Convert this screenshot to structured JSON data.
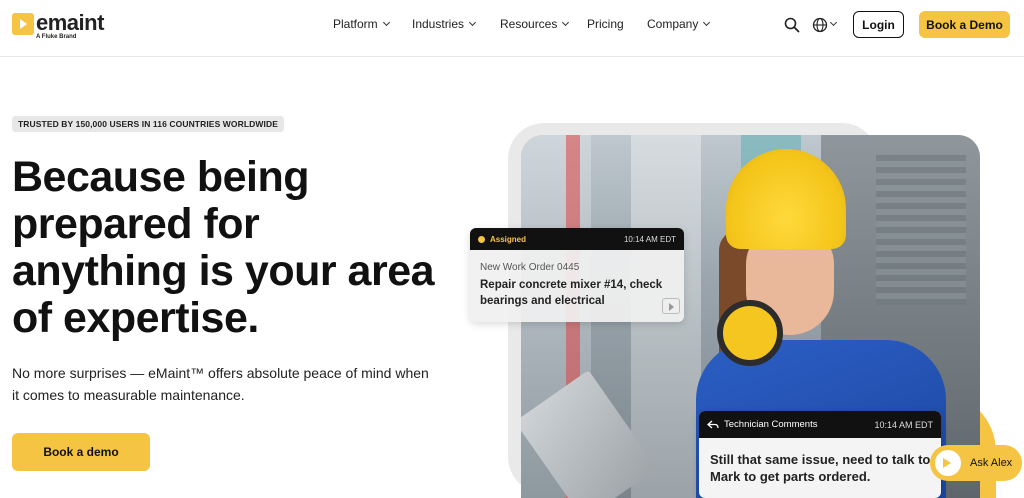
{
  "brand": {
    "name": "emaint",
    "subtitle": "A Fluke Brand",
    "accent": "#f6c443"
  },
  "nav": {
    "items": [
      {
        "label": "Platform",
        "has_dropdown": true
      },
      {
        "label": "Industries",
        "has_dropdown": true
      },
      {
        "label": "Resources",
        "has_dropdown": true
      },
      {
        "label": "Pricing",
        "has_dropdown": false
      },
      {
        "label": "Company",
        "has_dropdown": true
      }
    ],
    "icons": [
      "search-icon",
      "globe-icon"
    ],
    "login_label": "Login",
    "demo_label": "Book a Demo"
  },
  "hero": {
    "badge": "TRUSTED BY 150,000 USERS IN 116 COUNTRIES WORLDWIDE",
    "headline": "Because being prepared for anything is your area of expertise.",
    "subtext": "No more surprises — eMaint™ offers absolute peace of mind when it comes to measurable maintenance.",
    "cta_label": "Book a demo"
  },
  "assigned_card": {
    "status": "Assigned",
    "time": "10:14 AM EDT",
    "work_order": "New Work Order 0445",
    "description": "Repair concrete mixer #14, check bearings and electrical"
  },
  "tech_card": {
    "title": "Technician Comments",
    "time": "10:14 AM EDT",
    "comment": "Still that same issue, need to talk to Mark to get parts ordered."
  },
  "chat": {
    "label": "Ask Alex"
  }
}
